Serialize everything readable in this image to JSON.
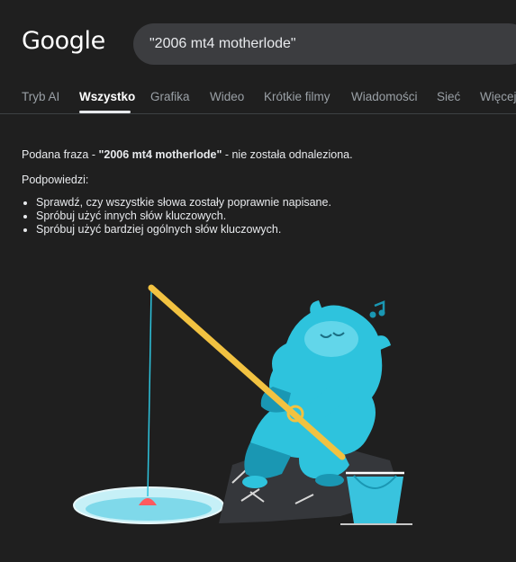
{
  "header": {
    "logo_text": "Google",
    "search": {
      "value": "\"2006 mt4 motherlode\""
    }
  },
  "tabs": [
    {
      "label": "Tryb AI",
      "active": false
    },
    {
      "label": "Wszystko",
      "active": true
    },
    {
      "label": "Grafika",
      "active": false
    },
    {
      "label": "Wideo",
      "active": false
    },
    {
      "label": "Krótkie filmy",
      "active": false
    },
    {
      "label": "Wiadomości",
      "active": false
    },
    {
      "label": "Sieć",
      "active": false
    },
    {
      "label": "Więcej",
      "active": false
    }
  ],
  "no_results": {
    "prefix": "Podana fraza - ",
    "query": "\"2006 mt4 motherlode\"",
    "suffix": " - nie została odnaleziona.",
    "tips_title": "Podpowiedzi:",
    "tips": [
      "Sprawdź, czy wszystkie słowa zostały poprawnie napisane.",
      "Spróbuj użyć innych słów kluczowych.",
      "Spróbuj użyć bardziej ogólnych słów kluczowych."
    ]
  },
  "illustration": {
    "subject": "fishing-monster",
    "colors": {
      "body": "#2ec3dd",
      "body_dark": "#1a97b3",
      "rod": "#f2c241",
      "ice_hole": "#c6f0f7",
      "rock": "#35373b",
      "bobber": "#ff5a5f",
      "bucket": "#39c3de"
    }
  }
}
